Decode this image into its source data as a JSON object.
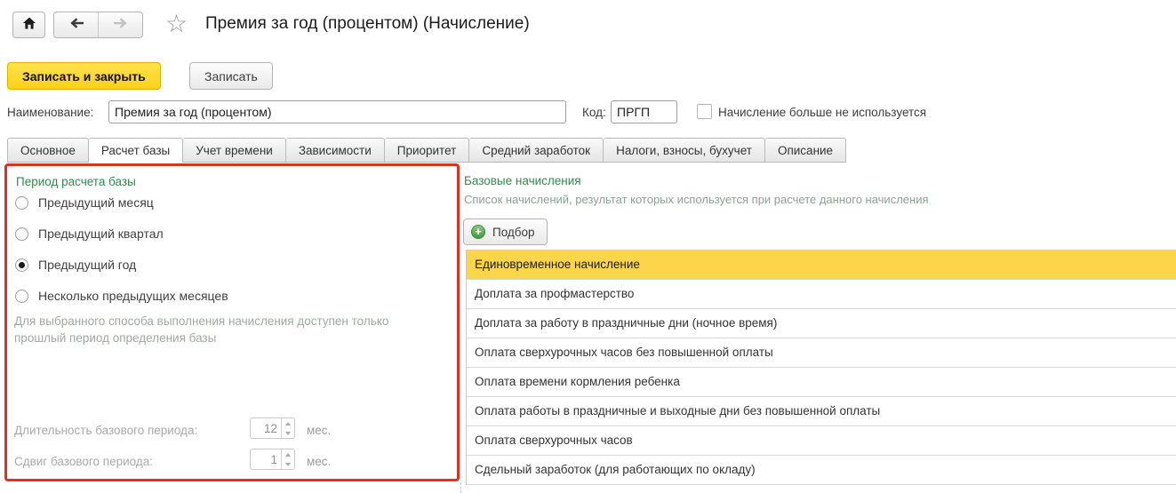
{
  "header": {
    "title": "Премия за год (процентом) (Начисление)"
  },
  "toolbar": {
    "save_close_label": "Записать и закрыть",
    "save_label": "Записать"
  },
  "form": {
    "name_label": "Наименование:",
    "name_value": "Премия за год (процентом)",
    "code_label": "Код:",
    "code_value": "ПРГП",
    "unused_checkbox_label": "Начисление больше не используется",
    "unused_checkbox_checked": false
  },
  "tabs": {
    "active": "Расчет базы",
    "items": [
      {
        "label": "Основное"
      },
      {
        "label": "Расчет базы"
      },
      {
        "label": "Учет времени"
      },
      {
        "label": "Зависимости"
      },
      {
        "label": "Приоритет"
      },
      {
        "label": "Средний заработок"
      },
      {
        "label": "Налоги, взносы, бухучет"
      },
      {
        "label": "Описание"
      }
    ]
  },
  "base_period_panel": {
    "title": "Период расчета базы",
    "options": [
      {
        "label": "Предыдущий месяц",
        "selected": false
      },
      {
        "label": "Предыдущий квартал",
        "selected": false
      },
      {
        "label": "Предыдущий год",
        "selected": true
      },
      {
        "label": "Несколько предыдущих месяцев",
        "selected": false
      }
    ],
    "hint": "Для выбранного способа выполнения начисления доступен только прошлый период определения базы",
    "duration_label": "Длительность базового периода:",
    "duration_value": "12",
    "duration_unit": "мес.",
    "shift_label": "Сдвиг базового периода:",
    "shift_value": "1",
    "shift_unit": "мес."
  },
  "base_accruals_panel": {
    "title": "Базовые начисления",
    "subtitle": "Список начислений, результат которых используется при расчете данного начисления",
    "pick_button_label": "Подбор",
    "selected_item": "Единовременное начисление",
    "items": [
      "Единовременное начисление",
      "Доплата за профмастерство",
      "Доплата за работу в праздничные дни (ночное время)",
      "Оплата сверхурочных часов без повышенной оплаты",
      "Оплата времени кормления ребенка",
      "Оплата работы в праздничные и выходные дни без повышенной оплаты",
      "Оплата сверхурочных часов",
      "Сдельный заработок (для работающих по окладу)"
    ]
  },
  "icons": {
    "home": "house-glyph",
    "back": "left-arrow",
    "forward": "right-arrow (disabled)",
    "favorite": "☆",
    "add": "+",
    "spinner": "up/down triangles"
  },
  "colors": {
    "accent-green": "#2f8b4e",
    "highlight-red": "#e2301f",
    "selection-yellow": "#fcd54b",
    "primary-button-yellow": "#fcd116",
    "primary-button-yellow-light": "#ffe34d"
  }
}
